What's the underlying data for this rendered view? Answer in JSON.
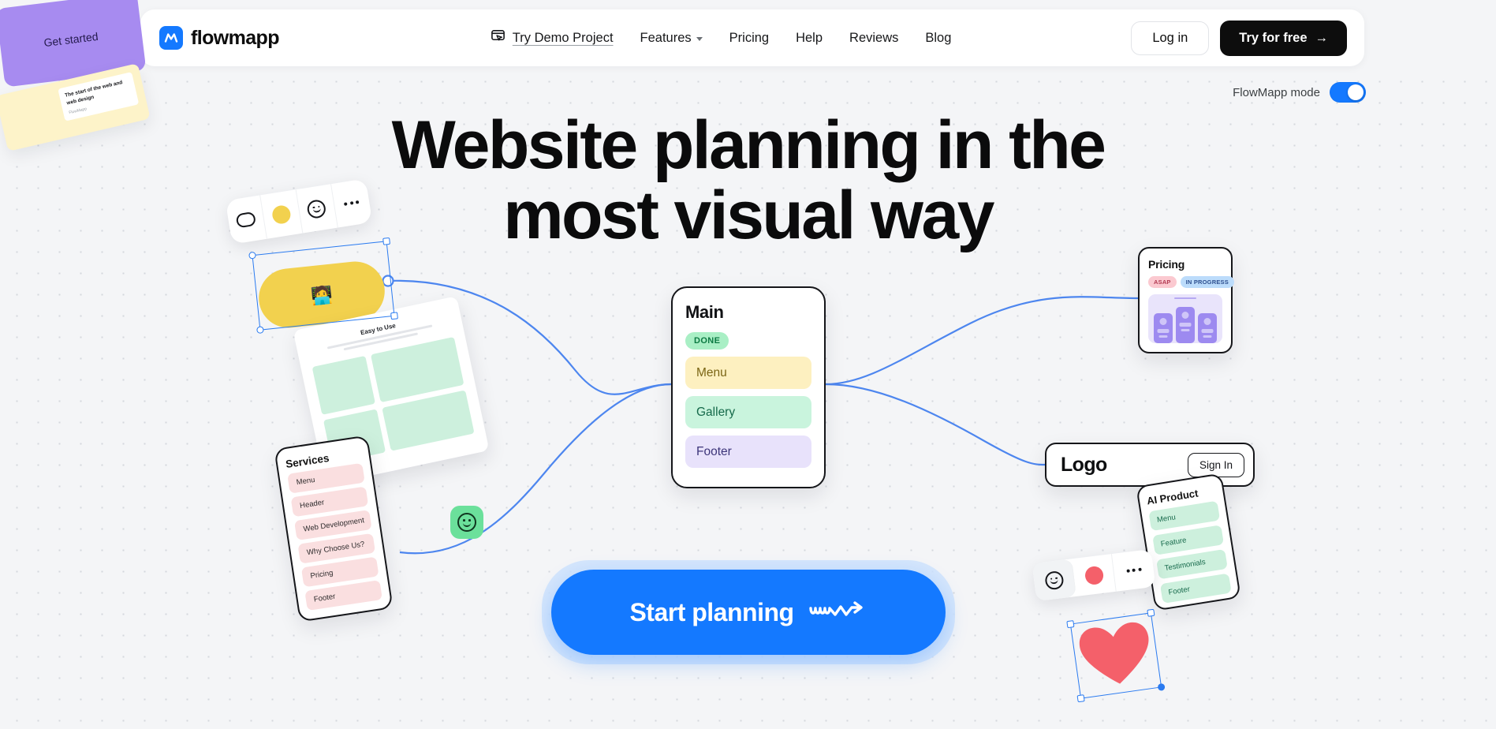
{
  "header": {
    "brand": "flowmapp",
    "brand_icon": "flowmapp-logo-icon",
    "nav": [
      {
        "label": "Try Demo Project",
        "icon": "demo-cursor-icon",
        "has_caret": false
      },
      {
        "label": "Features",
        "icon": "",
        "has_caret": true
      },
      {
        "label": "Pricing",
        "icon": "",
        "has_caret": false
      },
      {
        "label": "Help",
        "icon": "",
        "has_caret": false
      },
      {
        "label": "Reviews",
        "icon": "",
        "has_caret": false
      },
      {
        "label": "Blog",
        "icon": "",
        "has_caret": false
      }
    ],
    "login_label": "Log in",
    "try_label": "Try for free",
    "try_arrow": "→"
  },
  "mode": {
    "label": "FlowMapp mode",
    "enabled": true,
    "accent": "#1479ff"
  },
  "hero": {
    "line1": "Website planning in the",
    "line2": "most visual way",
    "cta_label": "Start planning",
    "cta_color": "#1479ff"
  },
  "canvas": {
    "main_card": {
      "title": "Main",
      "status": "DONE",
      "rows": [
        {
          "label": "Menu",
          "color": "#fdf0c0"
        },
        {
          "label": "Gallery",
          "color": "#c9f4dd"
        },
        {
          "label": "Footer",
          "color": "#e8e2fb"
        }
      ]
    },
    "services_card": {
      "title": "Services",
      "rows": [
        "Menu",
        "Header",
        "Web Development",
        "Why Choose Us?",
        "Pricing",
        "Footer"
      ],
      "row_color": "#fadfe0"
    },
    "ai_card": {
      "title": "AI Product",
      "rows": [
        "Menu",
        "Feature",
        "Testimonials",
        "Footer"
      ],
      "row_color": "#cdf0dd"
    },
    "pricing_card": {
      "title": "Pricing",
      "tags": [
        {
          "label": "ASAP",
          "color": "#fbc9d0"
        },
        {
          "label": "IN PROGRESS",
          "color": "#bcdcfb"
        }
      ]
    },
    "logo_card": {
      "logo_text": "Logo",
      "signin_label": "Sign In"
    },
    "wireframe_card": {
      "title": "Easy to Use"
    },
    "sticky_note": {
      "text": "The start of the web and web design",
      "meta": "FlowMapp"
    },
    "purple_card": {
      "label": "Get started",
      "color": "#a78bf0"
    },
    "blob": {
      "emoji": "🧑‍💻",
      "color": "#f2d14e"
    },
    "green_smiley": {
      "icon": "smiley-face-icon",
      "color": "#6be09b"
    },
    "heart": {
      "icon": "heart-icon",
      "color": "#f4606a"
    },
    "toolbar_left": [
      {
        "icon": "shape-pill-icon"
      },
      {
        "icon": "color-swatch-yellow-icon"
      },
      {
        "icon": "smiley-face-icon"
      },
      {
        "icon": "more-options-icon"
      }
    ],
    "toolbar_right": [
      {
        "icon": "smiley-face-icon"
      },
      {
        "icon": "color-swatch-red-icon"
      },
      {
        "icon": "more-options-icon"
      }
    ]
  }
}
